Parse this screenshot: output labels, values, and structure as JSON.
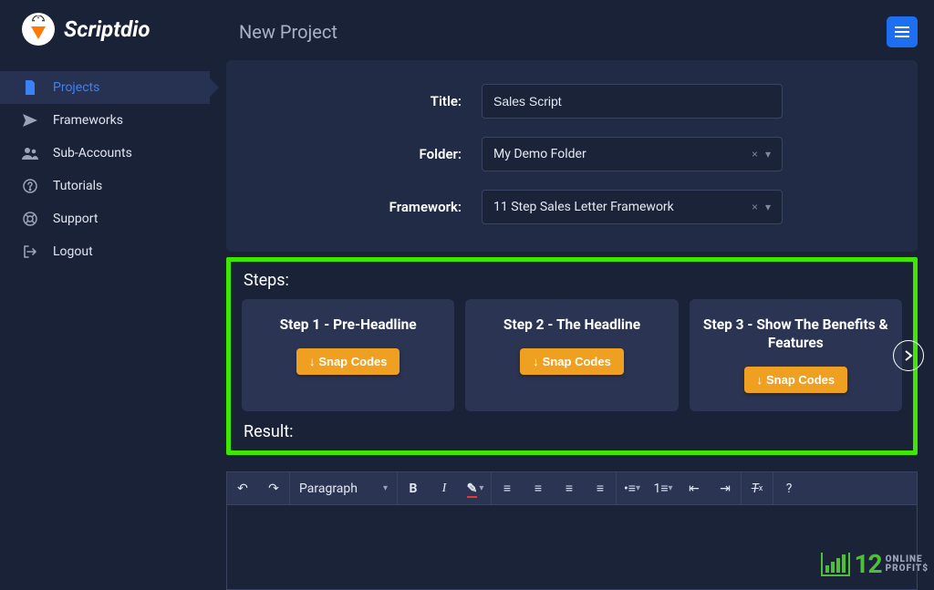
{
  "brand": {
    "name": "Scriptdio"
  },
  "nav": {
    "items": [
      {
        "label": "Projects"
      },
      {
        "label": "Frameworks"
      },
      {
        "label": "Sub-Accounts"
      },
      {
        "label": "Tutorials"
      },
      {
        "label": "Support"
      },
      {
        "label": "Logout"
      }
    ]
  },
  "page": {
    "title": "New Project"
  },
  "form": {
    "title_label": "Title:",
    "title_value": "Sales Script",
    "folder_label": "Folder:",
    "folder_value": "My Demo Folder",
    "framework_label": "Framework:",
    "framework_value": "11 Step Sales Letter Framework"
  },
  "steps": {
    "label": "Steps:",
    "snap_label": "Snap Codes",
    "items": [
      {
        "title": "Step 1 - Pre-Headline"
      },
      {
        "title": "Step 2 - The Headline"
      },
      {
        "title": "Step 3 - Show The Benefits & Features"
      }
    ]
  },
  "result": {
    "label": "Result:"
  },
  "editor": {
    "format_select": "Paragraph"
  },
  "watermark": {
    "num": "12",
    "line1": "ONLINE",
    "line2": "PROFIT$"
  }
}
